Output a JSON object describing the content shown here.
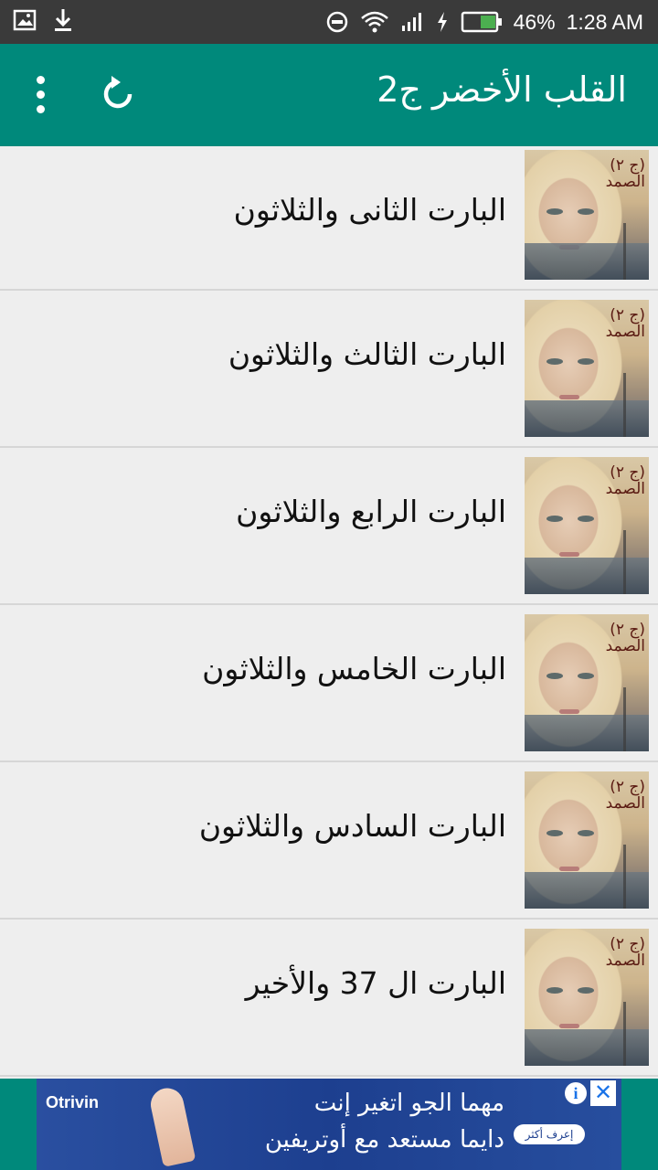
{
  "status_bar": {
    "battery_percent": "46%",
    "time": "1:28 AM",
    "icons": [
      "image-icon",
      "download-icon",
      "dnd-icon",
      "wifi-icon",
      "signal-icon",
      "charging-icon",
      "battery-icon"
    ]
  },
  "app_bar": {
    "title": "القلب الأخضر ج2",
    "icons": [
      "overflow-menu-icon",
      "refresh-icon"
    ]
  },
  "thumbnail": {
    "caption_line1": "(ج ٢)",
    "caption_line2": "الصمد"
  },
  "chapters": [
    {
      "label": "البارت الثانى والثلاثون"
    },
    {
      "label": "البارت الثالث والثلاثون"
    },
    {
      "label": "البارت الرابع والثلاثون"
    },
    {
      "label": "البارت الخامس والثلاثون"
    },
    {
      "label": "البارت السادس والثلاثون"
    },
    {
      "label": "البارت ال 37 والأخير"
    }
  ],
  "ad": {
    "brand": "Otrivin",
    "line1": "مهما الجو اتغير إنت",
    "line2": "دايما مستعد مع أوتريفين",
    "cta": "إعرف أكثر",
    "info": "i",
    "close": "✕"
  },
  "colors": {
    "primary": "#00897b",
    "status_bar": "#3a3a3a",
    "list_background": "#eeeeee",
    "battery_fill": "#4caf50"
  }
}
